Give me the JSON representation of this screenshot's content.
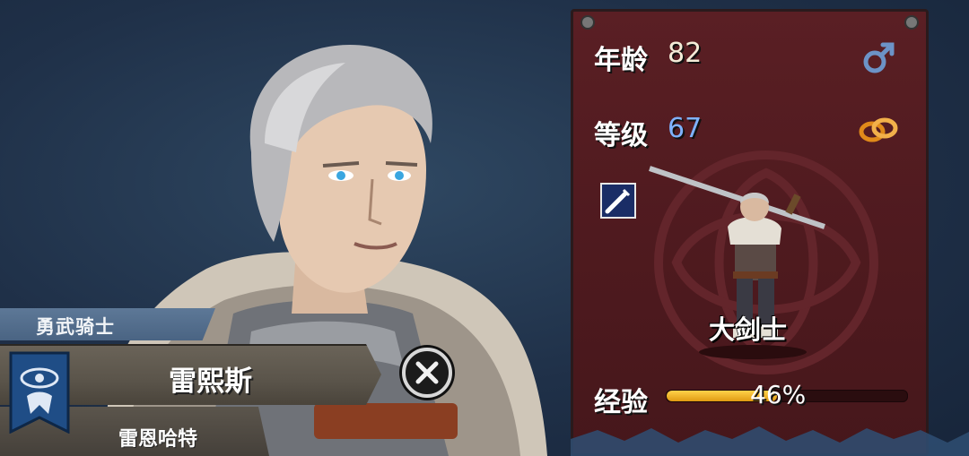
{
  "character": {
    "title": "勇武骑士",
    "name": "雷熙斯",
    "house": "雷恩哈特",
    "class_name": "大剑士"
  },
  "stats": {
    "age_label": "年龄",
    "age_value": "82",
    "level_label": "等级",
    "level_value": "67",
    "exp_label": "经验",
    "exp_percent_text": "46%",
    "exp_fraction": 0.46
  },
  "icons": {
    "gender": "male-symbol-icon",
    "marriage": "wedding-rings-icon",
    "class": "sword-class-icon",
    "close": "close-x-icon",
    "crest": "eye-banner-crest-icon"
  },
  "colors": {
    "level_value": "#7fb2ff",
    "age_value": "#f4ecd8",
    "xp_fill": "#f2b21e",
    "panel": "#4f1a1f",
    "title_band": "#5d7897"
  }
}
